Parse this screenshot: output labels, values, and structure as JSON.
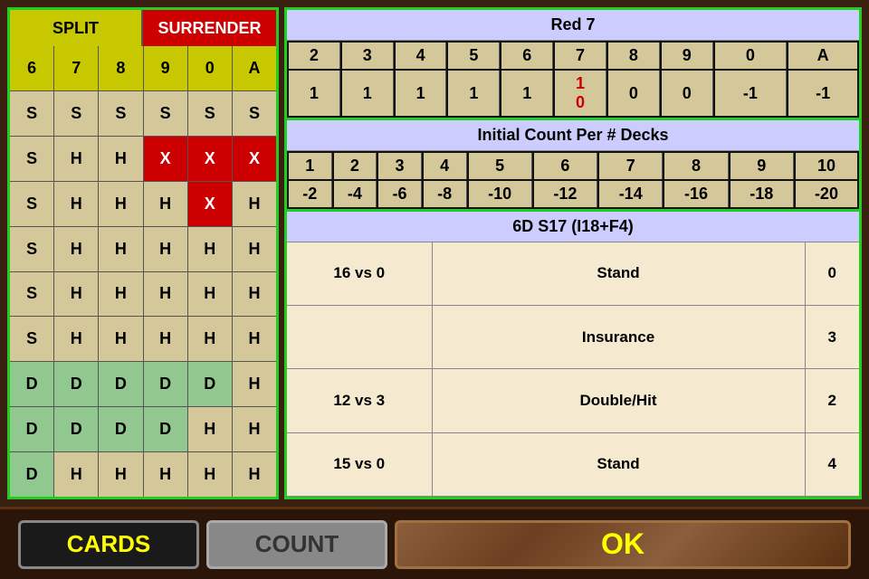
{
  "left": {
    "split_label": "SPLIT",
    "surrender_label": "SURRENDER",
    "header_row": [
      "6",
      "7",
      "8",
      "9",
      "0",
      "A"
    ],
    "rows": [
      [
        "S",
        "S",
        "S",
        "S",
        "S",
        "S"
      ],
      [
        "S",
        "H",
        "H",
        "X",
        "X",
        "X"
      ],
      [
        "S",
        "H",
        "H",
        "H",
        "X",
        "H"
      ],
      [
        "S",
        "H",
        "H",
        "H",
        "H",
        "H"
      ],
      [
        "S",
        "H",
        "H",
        "H",
        "H",
        "H"
      ],
      [
        "S",
        "H",
        "H",
        "H",
        "H",
        "H"
      ],
      [
        "D",
        "D",
        "D",
        "D",
        "D",
        "H"
      ],
      [
        "D",
        "D",
        "D",
        "D",
        "H",
        "H"
      ],
      [
        "D",
        "H",
        "H",
        "H",
        "H",
        "H"
      ]
    ]
  },
  "right": {
    "red7_title": "Red 7",
    "red7_header": [
      "2",
      "3",
      "4",
      "5",
      "6",
      "7",
      "8",
      "9",
      "0",
      "A"
    ],
    "red7_values": [
      "1",
      "1",
      "1",
      "1",
      "1",
      "10",
      "-",
      "0",
      "0",
      "-1",
      "-1"
    ],
    "red7_row2": [
      "1",
      "1",
      "1",
      "1",
      "1",
      "",
      "0",
      "0",
      "-1",
      "-1"
    ],
    "red7_special": "10",
    "initial_count_title": "Initial Count Per # Decks",
    "initial_header": [
      "1",
      "2",
      "3",
      "4",
      "5",
      "6",
      "7",
      "8",
      "9",
      "10"
    ],
    "initial_values": [
      "-2",
      "-4",
      "-6",
      "-8",
      "-10",
      "-12",
      "-14",
      "-16",
      "-18",
      "-20"
    ],
    "index_title": "6D S17 (I18+F4)",
    "index_rows": [
      {
        "left": "16 vs 0",
        "action": "Stand",
        "val": "0"
      },
      {
        "left": "",
        "action": "Insurance",
        "val": "3"
      },
      {
        "left": "12 vs 3",
        "action": "Double/Hit",
        "val": "2"
      },
      {
        "left": "15 vs 0",
        "action": "Stand",
        "val": "4"
      }
    ]
  },
  "bottom": {
    "cards_label": "CARDS",
    "count_label": "COUNT",
    "ok_label": "OK"
  }
}
